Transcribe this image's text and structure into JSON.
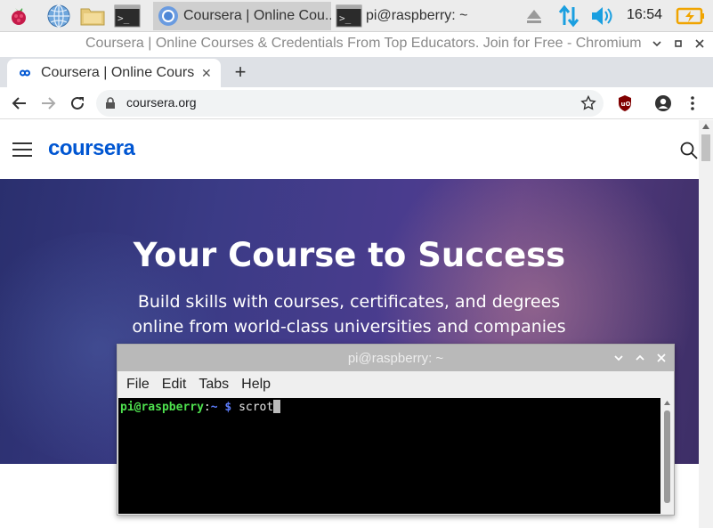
{
  "taskbar": {
    "launchers": [
      "raspberry-menu-icon",
      "web-browser-icon",
      "file-manager-icon",
      "terminal-icon"
    ],
    "tasks": [
      {
        "label": "Coursera | Online Cou...",
        "icon": "chromium-icon",
        "active": true
      },
      {
        "label": "pi@raspberry: ~",
        "icon": "terminal-icon",
        "active": false
      }
    ],
    "clock": "16:54",
    "colors": {
      "network": "#1a9fe0",
      "volume": "#1a9fe0",
      "battery": "#f0a400"
    }
  },
  "window": {
    "title": "Coursera | Online Courses & Credentials From Top Educators. Join for Free - Chromium"
  },
  "browser": {
    "tab_title": "Coursera | Online Courses & Credentials",
    "new_tab": "+",
    "url": "coursera.org"
  },
  "page": {
    "logo": "coursera",
    "hero_title": "Your Course to Success",
    "hero_subtitle": "Build skills with courses, certificates, and degrees online from world-class universities and companies",
    "brand_color": "#0056d2"
  },
  "terminal": {
    "title": "pi@raspberry: ~",
    "menu": [
      "File",
      "Edit",
      "Tabs",
      "Help"
    ],
    "prompt_user": "pi@raspberry",
    "prompt_sep": ":",
    "prompt_path": "~",
    "prompt_sign": "$",
    "command": "scrot"
  }
}
